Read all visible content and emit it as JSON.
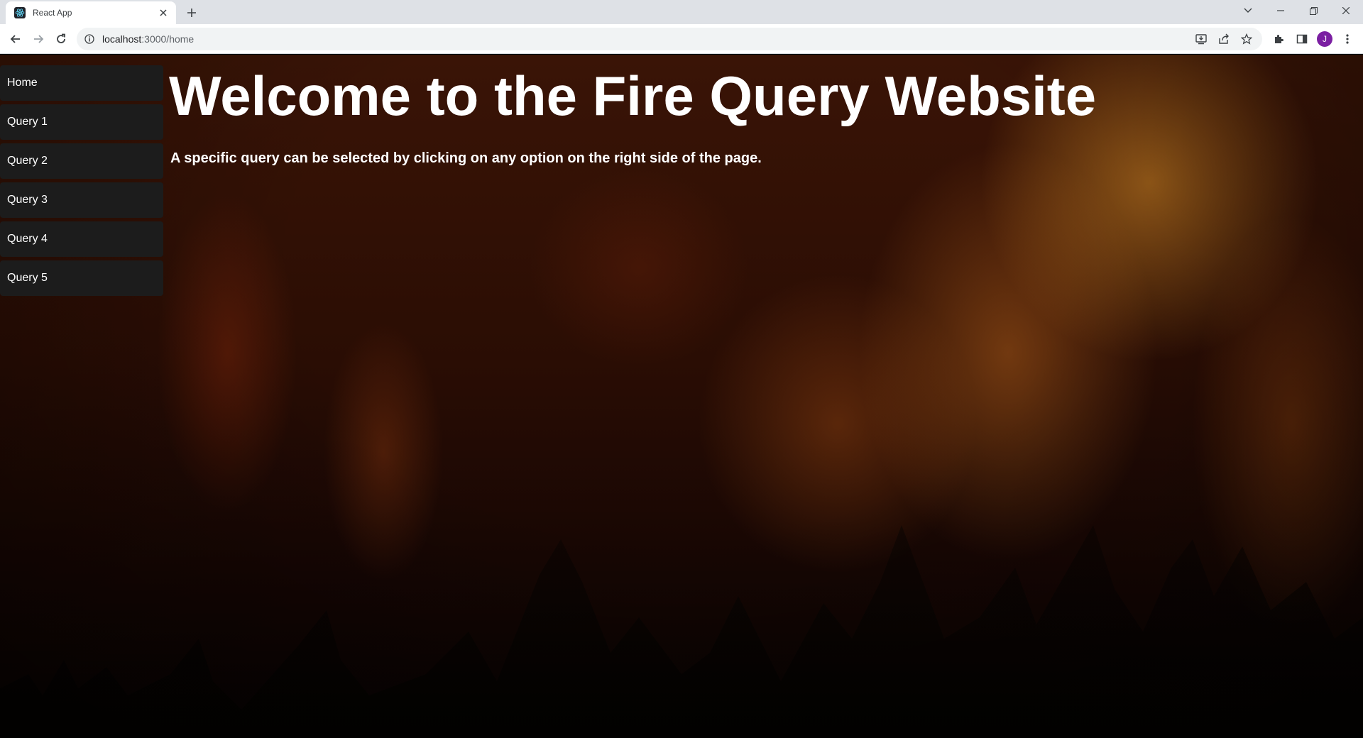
{
  "browser": {
    "tab_title": "React App",
    "url_host": "localhost",
    "url_path": ":3000/home",
    "profile_initial": "J"
  },
  "icons": {
    "favicon": "react-icon",
    "tab_close": "close-icon",
    "new_tab": "plus-icon",
    "back": "arrow-left-icon",
    "forward": "arrow-right-icon",
    "reload": "reload-icon",
    "site_info": "info-icon",
    "install": "install-icon",
    "share": "share-icon",
    "bookmark": "star-icon",
    "extensions": "puzzle-icon",
    "side_panel": "side-panel-icon",
    "menu": "kebab-menu-icon"
  },
  "colors": {
    "nav_button_bg": "#1c1c1c",
    "text": "#ffffff",
    "avatar": "#7b1fa2"
  },
  "sidebar": {
    "items": [
      {
        "label": "Home"
      },
      {
        "label": "Query 1"
      },
      {
        "label": "Query 2"
      },
      {
        "label": "Query 3"
      },
      {
        "label": "Query 4"
      },
      {
        "label": "Query 5"
      }
    ]
  },
  "main": {
    "title": "Welcome to the Fire Query Website",
    "description": "A specific query can be selected by clicking on any option on the right side of the page."
  }
}
